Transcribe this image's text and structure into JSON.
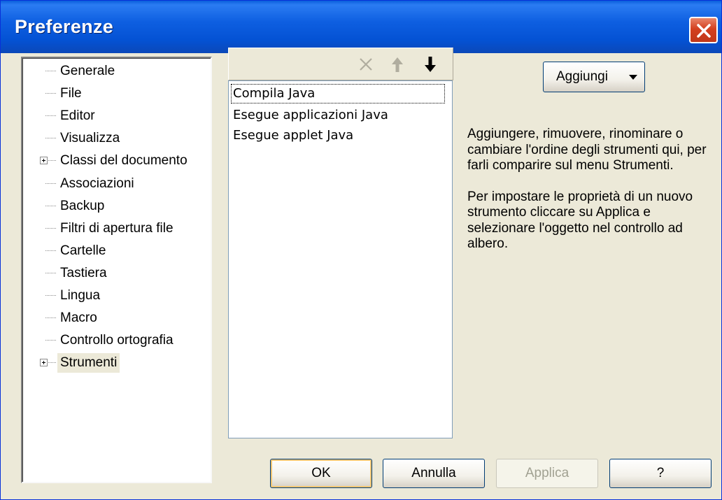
{
  "window": {
    "title": "Preferenze",
    "close_icon": "close-icon"
  },
  "tree": {
    "items": [
      {
        "label": "Generale",
        "expandable": false
      },
      {
        "label": "File",
        "expandable": false
      },
      {
        "label": "Editor",
        "expandable": false
      },
      {
        "label": "Visualizza",
        "expandable": false
      },
      {
        "label": "Classi del documento",
        "expandable": true
      },
      {
        "label": "Associazioni",
        "expandable": false
      },
      {
        "label": "Backup",
        "expandable": false
      },
      {
        "label": "Filtri di apertura file",
        "expandable": false
      },
      {
        "label": "Cartelle",
        "expandable": false
      },
      {
        "label": "Tastiera",
        "expandable": false
      },
      {
        "label": "Lingua",
        "expandable": false
      },
      {
        "label": "Macro",
        "expandable": false
      },
      {
        "label": "Controllo ortografia",
        "expandable": false
      },
      {
        "label": "Strumenti",
        "expandable": true,
        "selected": true
      }
    ]
  },
  "toolbar": {
    "delete_icon": "delete-x-icon",
    "move_up_icon": "arrow-up-icon",
    "move_down_icon": "arrow-down-icon"
  },
  "tools": {
    "items": [
      {
        "label": "Compila Java",
        "focused": true
      },
      {
        "label": "Esegue applicazioni Java"
      },
      {
        "label": "Esegue applet Java"
      }
    ]
  },
  "add_menu": {
    "label": "Aggiungi"
  },
  "help": {
    "paragraph1": "Aggiungere, rimuovere, rinominare o cambiare l'ordine degli strumenti qui, per farli comparire sul menu Strumenti.",
    "paragraph2": "Per impostare le proprietà di un nuovo strumento cliccare su Applica e selezionare l'oggetto nel controllo ad albero."
  },
  "buttons": {
    "ok": "OK",
    "cancel": "Annulla",
    "apply": "Applica",
    "help": "?"
  },
  "colors": {
    "titlebar": "#0452d4",
    "dialog_bg": "#ece9d8",
    "close_button": "#d3401f"
  }
}
